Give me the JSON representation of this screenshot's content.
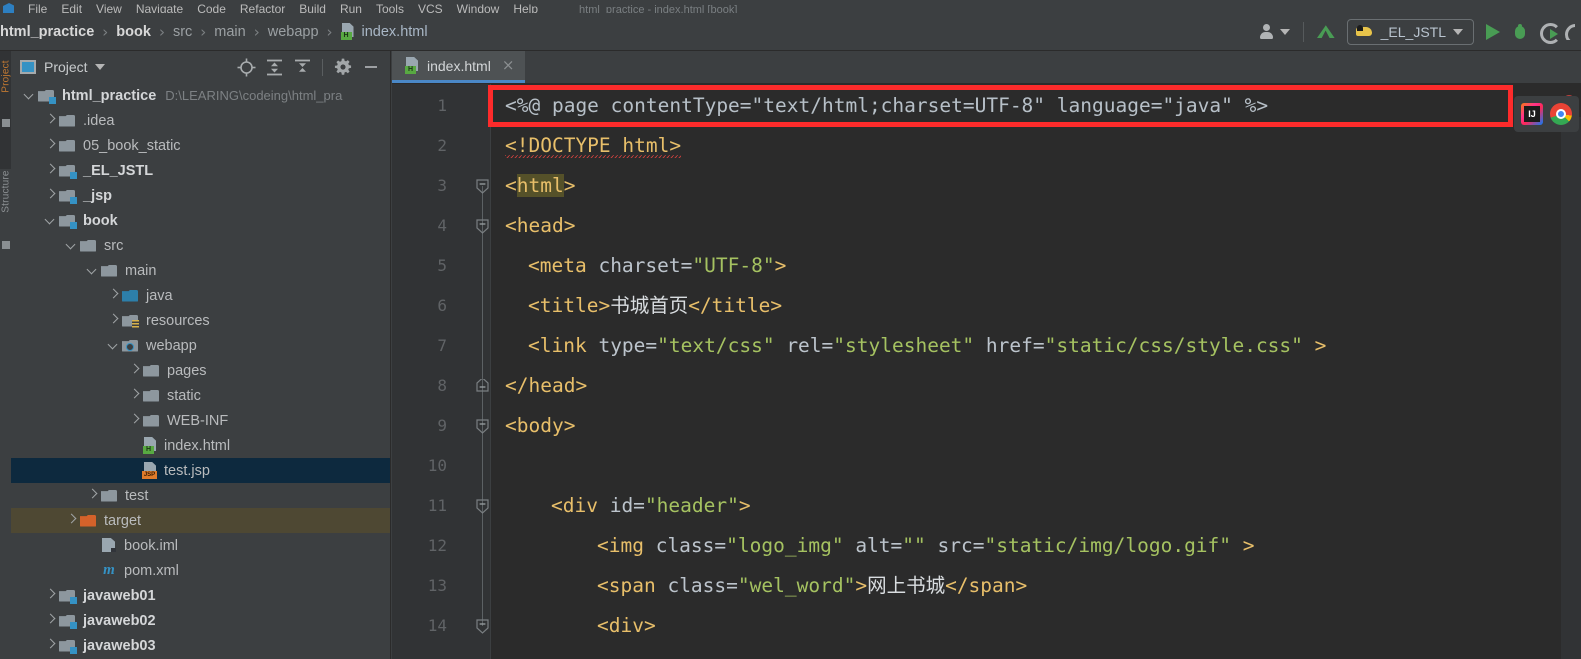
{
  "window": {
    "title": "html_practice - index.html [book]"
  },
  "menubar": {
    "items": [
      {
        "label": "File"
      },
      {
        "label": "Edit"
      },
      {
        "label": "View"
      },
      {
        "label": "Navigate"
      },
      {
        "label": "Code"
      },
      {
        "label": "Refactor"
      },
      {
        "label": "Build"
      },
      {
        "label": "Run"
      },
      {
        "label": "Tools"
      },
      {
        "label": "VCS"
      },
      {
        "label": "Window"
      },
      {
        "label": "Help"
      }
    ]
  },
  "breadcrumb": {
    "items": [
      {
        "label": "html_practice",
        "style": "bold"
      },
      {
        "label": "book",
        "style": "bold"
      },
      {
        "label": "src",
        "style": "dim"
      },
      {
        "label": "main",
        "style": "dim"
      },
      {
        "label": "webapp",
        "style": "dim"
      },
      {
        "label": "index.html",
        "style": "file"
      }
    ],
    "separator": "›"
  },
  "toolbar": {
    "account_icon": "person-icon",
    "update_icon": "update-project-icon",
    "run_config": {
      "label": "_EL_JSTL",
      "icon": "tomcat-icon",
      "caret": "chevron-down-icon"
    },
    "run_icon": "run-icon",
    "debug_icon": "debug-icon",
    "rerun_icon": "rerun-icon",
    "accent_green": "#499c54"
  },
  "stripe": {
    "project_label": "Project",
    "structure_label": "Structure",
    "active_color": "#c07832"
  },
  "project_panel": {
    "title": "Project",
    "icons": [
      {
        "name": "locate-target-icon"
      },
      {
        "name": "expand-all-icon"
      },
      {
        "name": "collapse-all-icon"
      },
      {
        "name": "gear-icon"
      },
      {
        "name": "minimize-icon"
      }
    ],
    "tree": [
      {
        "indent": 0,
        "arrow": "down",
        "icon": "folder-module",
        "label": "html_practice",
        "bold": true,
        "path": "D:\\LEARING\\codeing\\html_pra",
        "state": "normal"
      },
      {
        "indent": 1,
        "arrow": "right",
        "icon": "folder",
        "label": ".idea",
        "bold": false,
        "path": "",
        "state": "normal"
      },
      {
        "indent": 1,
        "arrow": "right",
        "icon": "folder",
        "label": "05_book_static",
        "bold": false,
        "path": "",
        "state": "normal"
      },
      {
        "indent": 1,
        "arrow": "right",
        "icon": "folder-module",
        "label": "_EL_JSTL",
        "bold": true,
        "path": "",
        "state": "normal"
      },
      {
        "indent": 1,
        "arrow": "right",
        "icon": "folder-module",
        "label": "_jsp",
        "bold": true,
        "path": "",
        "state": "normal"
      },
      {
        "indent": 1,
        "arrow": "down",
        "icon": "folder-module",
        "label": "book",
        "bold": true,
        "path": "",
        "state": "normal"
      },
      {
        "indent": 2,
        "arrow": "down",
        "icon": "folder",
        "label": "src",
        "bold": false,
        "path": "",
        "state": "normal"
      },
      {
        "indent": 3,
        "arrow": "down",
        "icon": "folder",
        "label": "main",
        "bold": false,
        "path": "",
        "state": "normal"
      },
      {
        "indent": 4,
        "arrow": "right",
        "icon": "folder-source",
        "label": "java",
        "bold": false,
        "path": "",
        "state": "normal"
      },
      {
        "indent": 4,
        "arrow": "right",
        "icon": "folder-resources",
        "label": "resources",
        "bold": false,
        "path": "",
        "state": "normal"
      },
      {
        "indent": 4,
        "arrow": "down",
        "icon": "folder-webapp",
        "label": "webapp",
        "bold": false,
        "path": "",
        "state": "normal"
      },
      {
        "indent": 5,
        "arrow": "right",
        "icon": "folder",
        "label": "pages",
        "bold": false,
        "path": "",
        "state": "normal"
      },
      {
        "indent": 5,
        "arrow": "right",
        "icon": "folder",
        "label": "static",
        "bold": false,
        "path": "",
        "state": "normal"
      },
      {
        "indent": 5,
        "arrow": "right",
        "icon": "folder",
        "label": "WEB-INF",
        "bold": false,
        "path": "",
        "state": "normal"
      },
      {
        "indent": 5,
        "arrow": "none",
        "icon": "file-html",
        "label": "index.html",
        "bold": false,
        "path": "",
        "state": "normal"
      },
      {
        "indent": 5,
        "arrow": "none",
        "icon": "file-jsp",
        "label": "test.jsp",
        "bold": false,
        "path": "",
        "state": "selected"
      },
      {
        "indent": 3,
        "arrow": "right",
        "icon": "folder",
        "label": "test",
        "bold": false,
        "path": "",
        "state": "normal"
      },
      {
        "indent": 2,
        "arrow": "right",
        "icon": "folder-target",
        "label": "target",
        "bold": false,
        "path": "",
        "state": "highlight"
      },
      {
        "indent": 3,
        "arrow": "none",
        "icon": "file-iml",
        "label": "book.iml",
        "bold": false,
        "path": "",
        "state": "normal"
      },
      {
        "indent": 3,
        "arrow": "none",
        "icon": "file-maven",
        "label": "pom.xml",
        "bold": false,
        "path": "",
        "state": "normal"
      },
      {
        "indent": 1,
        "arrow": "right",
        "icon": "folder-module",
        "label": "javaweb01",
        "bold": true,
        "path": "",
        "state": "normal"
      },
      {
        "indent": 1,
        "arrow": "right",
        "icon": "folder-module",
        "label": "javaweb02",
        "bold": true,
        "path": "",
        "state": "normal"
      },
      {
        "indent": 1,
        "arrow": "right",
        "icon": "folder-module",
        "label": "javaweb03",
        "bold": true,
        "path": "",
        "state": "normal"
      }
    ]
  },
  "editor": {
    "tab": {
      "label": "index.html",
      "icon": "file-html",
      "close": "×"
    },
    "line_numbers": [
      1,
      2,
      3,
      4,
      5,
      6,
      7,
      8,
      9,
      10,
      11,
      12,
      13,
      14
    ],
    "fold_markers": [
      {
        "line": 3,
        "dir": "down"
      },
      {
        "line": 4,
        "dir": "down"
      },
      {
        "line": 8,
        "dir": "up"
      },
      {
        "line": 9,
        "dir": "down"
      },
      {
        "line": 11,
        "dir": "down"
      },
      {
        "line": 14,
        "dir": "down"
      }
    ],
    "lines": [
      {
        "n": 1,
        "indent": 0,
        "tokens": [
          {
            "t": "<%@ page contentType=\"text/html;charset=UTF-8\" language=\"java\" %>",
            "c": "pl"
          }
        ]
      },
      {
        "n": 2,
        "indent": 0,
        "tokens": [
          {
            "t": "<!DOCTYPE html>",
            "c": "tg squiggle"
          }
        ]
      },
      {
        "n": 3,
        "indent": 0,
        "tokens": [
          {
            "t": "<",
            "c": "tg"
          },
          {
            "t": "html",
            "c": "tg brace-hl"
          },
          {
            "t": ">",
            "c": "tg"
          }
        ]
      },
      {
        "n": 4,
        "indent": 0,
        "tokens": [
          {
            "t": "<head>",
            "c": "tg"
          }
        ]
      },
      {
        "n": 5,
        "indent": 1,
        "tokens": [
          {
            "t": "<meta ",
            "c": "tg"
          },
          {
            "t": "charset=",
            "c": "at"
          },
          {
            "t": "\"UTF-8\"",
            "c": "vl"
          },
          {
            "t": ">",
            "c": "tg"
          }
        ]
      },
      {
        "n": 6,
        "indent": 1,
        "tokens": [
          {
            "t": "<title>",
            "c": "tg"
          },
          {
            "t": "书城首页",
            "c": "txt"
          },
          {
            "t": "</title>",
            "c": "tg"
          }
        ]
      },
      {
        "n": 7,
        "indent": 1,
        "tokens": [
          {
            "t": "<link ",
            "c": "tg"
          },
          {
            "t": "type=",
            "c": "at"
          },
          {
            "t": "\"text/css\"",
            "c": "vl"
          },
          {
            "t": " ",
            "c": "pl"
          },
          {
            "t": "rel=",
            "c": "at"
          },
          {
            "t": "\"stylesheet\"",
            "c": "vl"
          },
          {
            "t": " ",
            "c": "pl"
          },
          {
            "t": "href=",
            "c": "at"
          },
          {
            "t": "\"static/css/style.css\"",
            "c": "vl"
          },
          {
            "t": " >",
            "c": "tg"
          }
        ]
      },
      {
        "n": 8,
        "indent": 0,
        "tokens": [
          {
            "t": "</head>",
            "c": "tg"
          }
        ]
      },
      {
        "n": 9,
        "indent": 0,
        "tokens": [
          {
            "t": "<body>",
            "c": "tg"
          }
        ]
      },
      {
        "n": 10,
        "indent": 0,
        "tokens": []
      },
      {
        "n": 11,
        "indent": 2,
        "tokens": [
          {
            "t": "<div ",
            "c": "tg"
          },
          {
            "t": "id=",
            "c": "at"
          },
          {
            "t": "\"header\"",
            "c": "vl"
          },
          {
            "t": ">",
            "c": "tg"
          }
        ]
      },
      {
        "n": 12,
        "indent": 4,
        "tokens": [
          {
            "t": "<img ",
            "c": "tg"
          },
          {
            "t": "class=",
            "c": "at"
          },
          {
            "t": "\"logo_img\"",
            "c": "vl"
          },
          {
            "t": " ",
            "c": "pl"
          },
          {
            "t": "alt=",
            "c": "at"
          },
          {
            "t": "\"\"",
            "c": "vl"
          },
          {
            "t": " ",
            "c": "pl"
          },
          {
            "t": "src=",
            "c": "at"
          },
          {
            "t": "\"static/img/logo.gif\"",
            "c": "vl"
          },
          {
            "t": " >",
            "c": "tg"
          }
        ]
      },
      {
        "n": 13,
        "indent": 4,
        "tokens": [
          {
            "t": "<span ",
            "c": "tg"
          },
          {
            "t": "class=",
            "c": "at"
          },
          {
            "t": "\"wel_word\"",
            "c": "vl"
          },
          {
            "t": ">",
            "c": "tg"
          },
          {
            "t": "网上书城",
            "c": "txt"
          },
          {
            "t": "</span>",
            "c": "tg"
          }
        ]
      },
      {
        "n": 14,
        "indent": 4,
        "tokens": [
          {
            "t": "<div>",
            "c": "tg"
          }
        ]
      }
    ],
    "annotation": {
      "color": "#fd2b2b",
      "target_line": 1
    },
    "status_indicator": {
      "name": "error-indicator",
      "color": "#bc3f3c"
    },
    "browser_popup": [
      {
        "name": "intellij-preview-icon"
      },
      {
        "name": "chrome-preview-icon"
      }
    ]
  }
}
